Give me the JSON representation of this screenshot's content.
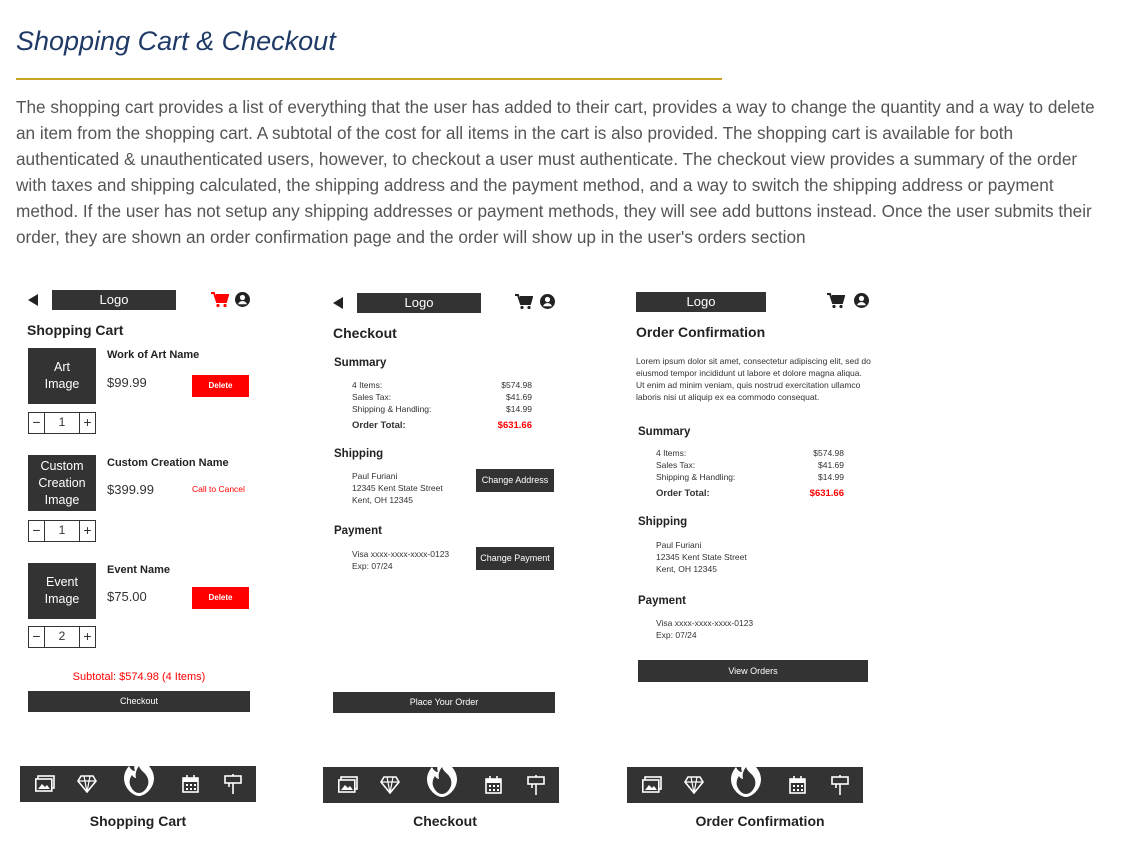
{
  "page": {
    "title": "Shopping Cart & Checkout",
    "description": "The shopping cart provides a list of everything that the user has added to their cart, provides a way to change the quantity and a way to delete an item from the shopping cart.  A subtotal of the cost for all items in the cart is also provided.  The shopping cart is available for both authenticated & unauthenticated users, however, to checkout a user must authenticate.  The checkout view provides a summary of the order with taxes and shipping calculated, the shipping address and the payment method, and a way to switch the shipping address or payment method.  If the user has not setup any shipping addresses or payment methods, they will see add buttons instead. Once the user submits their order, they are shown an order confirmation page and the order will show up in the user's orders section"
  },
  "common": {
    "logo": "Logo",
    "icons": [
      "back-arrow-icon",
      "cart-icon",
      "account-icon",
      "gallery-icon",
      "diamond-icon",
      "flame-icon",
      "calendar-icon",
      "signpost-icon"
    ],
    "accent_color": "#ff0000",
    "dark_color": "#333333"
  },
  "cart": {
    "heading": "Shopping Cart",
    "items": [
      {
        "image_label": "Art\nImage",
        "name": "Work of Art Name",
        "price": "$99.99",
        "action": "Delete",
        "qty": "1"
      },
      {
        "image_label": "Custom\nCreation\nImage",
        "name": "Custom Creation Name",
        "price": "$399.99",
        "action": "Call to Cancel",
        "qty": "1"
      },
      {
        "image_label": "Event\nImage",
        "name": "Event Name",
        "price": "$75.00",
        "action": "Delete",
        "qty": "2"
      }
    ],
    "minus": "−",
    "plus": "+",
    "subtotal": "Subtotal: $574.98 (4 Items)",
    "checkout_button": "Checkout",
    "caption": "Shopping Cart"
  },
  "checkout": {
    "heading": "Checkout",
    "summary_heading": "Summary",
    "rows": [
      {
        "label": "4 Items:",
        "value": "$574.98"
      },
      {
        "label": "Sales Tax:",
        "value": "$41.69"
      },
      {
        "label": "Shipping & Handling:",
        "value": "$14.99"
      }
    ],
    "total_label": "Order Total:",
    "total_value": "$631.66",
    "shipping_heading": "Shipping",
    "address": [
      "Paul Furiani",
      "12345 Kent State Street",
      "Kent, OH 12345"
    ],
    "change_address": "Change Address",
    "payment_heading": "Payment",
    "payment": [
      "Visa xxxx-xxxx-xxxx-0123",
      "Exp: 07/24"
    ],
    "change_payment": "Change Payment",
    "place_order": "Place Your Order",
    "caption": "Checkout"
  },
  "confirmation": {
    "heading": "Order Confirmation",
    "body": "Lorem ipsum dolor sit amet, consectetur adipiscing elit, sed do eiusmod tempor incididunt ut labore et dolore magna aliqua. Ut enim ad minim veniam, quis nostrud exercitation ullamco laboris nisi ut aliquip ex ea commodo consequat.",
    "summary_heading": "Summary",
    "rows": [
      {
        "label": "4 Items:",
        "value": "$574.98"
      },
      {
        "label": "Sales Tax:",
        "value": "$41.69"
      },
      {
        "label": "Shipping & Handling:",
        "value": "$14.99"
      }
    ],
    "total_label": "Order Total:",
    "total_value": "$631.66",
    "shipping_heading": "Shipping",
    "address": [
      "Paul Furiani",
      "12345 Kent State Street",
      "Kent, OH 12345"
    ],
    "payment_heading": "Payment",
    "payment": [
      "Visa xxxx-xxxx-xxxx-0123",
      "Exp: 07/24"
    ],
    "view_orders": "View Orders",
    "caption": "Order Confirmation"
  }
}
